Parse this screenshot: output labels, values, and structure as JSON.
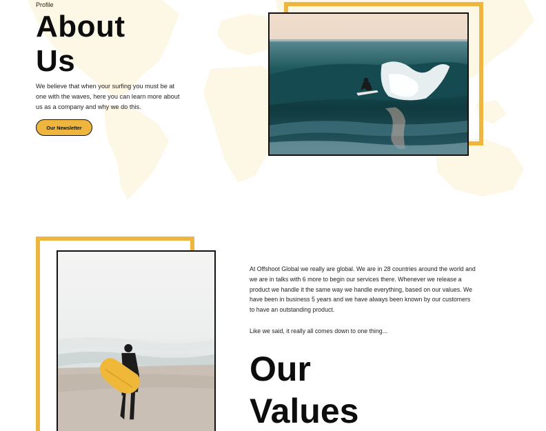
{
  "hero": {
    "eyebrow": "Profile",
    "title_line1": "About",
    "title_line2": "Us",
    "description": "We believe that when your surfing you must be at one with the waves, here you can learn more about us as a company and why we do this.",
    "button_label": "Our Newsletter"
  },
  "about": {
    "paragraph": "At Offshoot Global we really are global. We are in 28 countries around the world and we are in talks with 6 more to begin our services there. Whenever we release a product we handle it the same way we handle everything, based on our values. We have been in business 5 years and we have always been known by our customers to have an outstanding product.",
    "tagline": "Like we said, it really all comes down to one thing...",
    "values_line1": "Our",
    "values_line2": "Values"
  },
  "images": {
    "surfer_wave": "surfer-riding-wave-photo",
    "surfer_beach": "surfer-carrying-board-photo",
    "background": "world-map-illustration"
  },
  "colors": {
    "accent": "#eeb63e",
    "text": "#111111",
    "background": "#ffffff",
    "map": "#fdf6e3"
  }
}
